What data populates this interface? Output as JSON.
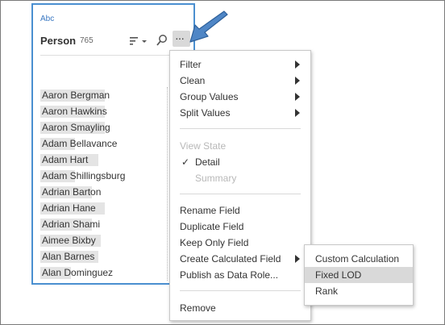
{
  "card": {
    "type_label": "Abc",
    "field_name": "Person",
    "count": "765",
    "icons": [
      "sort-icon",
      "search-icon",
      "more-options-icon"
    ],
    "values": [
      {
        "text": "Aaron Bergman",
        "hl": 0.5
      },
      {
        "text": "Aaron Hawkins",
        "hl": 0.5
      },
      {
        "text": "Aaron Smayling",
        "hl": 0.5
      },
      {
        "text": "Adam Bellavance",
        "hl": 0.27
      },
      {
        "text": "Adam Hart",
        "hl": 0.45
      },
      {
        "text": "Adam Shillingsburg",
        "hl": 0.27
      },
      {
        "text": "Adrian Barton",
        "hl": 0.4
      },
      {
        "text": "Adrian Hane",
        "hl": 0.5
      },
      {
        "text": "Adrian Shami",
        "hl": 0.4
      },
      {
        "text": "Aimee Bixby",
        "hl": 0.47
      },
      {
        "text": "Alan Barnes",
        "hl": 0.45
      },
      {
        "text": "Alan Dominguez",
        "hl": 0.24
      }
    ]
  },
  "menu": {
    "items": [
      {
        "label": "Filter",
        "submenu": true
      },
      {
        "label": "Clean",
        "submenu": true
      },
      {
        "label": "Group Values",
        "submenu": true
      },
      {
        "label": "Split Values",
        "submenu": true
      },
      {
        "label": "View State",
        "disabled": true
      },
      {
        "label": "Detail",
        "checked": true
      },
      {
        "label": "Summary",
        "disabled": true
      },
      {
        "label": "Rename Field"
      },
      {
        "label": "Duplicate Field"
      },
      {
        "label": "Keep Only Field"
      },
      {
        "label": "Create Calculated Field",
        "submenu": true
      },
      {
        "label": "Publish as Data Role..."
      },
      {
        "label": "Remove"
      }
    ],
    "check_mark": "✓"
  },
  "submenu": {
    "items": [
      {
        "label": "Custom Calculation"
      },
      {
        "label": "Fixed LOD",
        "active": true
      },
      {
        "label": "Rank"
      }
    ]
  },
  "colors": {
    "card_border": "#4a8fd0",
    "arrow_fill": "#4f86c6",
    "highlight": "#d9d9d9"
  }
}
